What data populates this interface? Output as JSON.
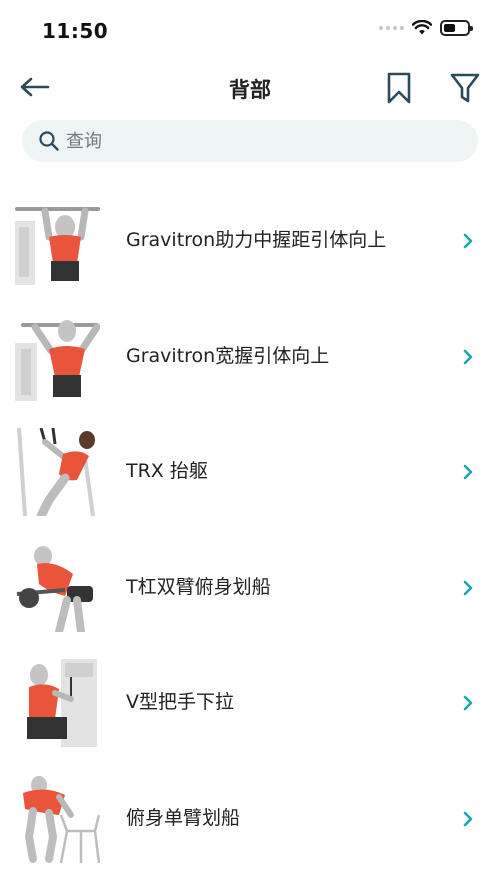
{
  "status": {
    "time": "11:50"
  },
  "nav": {
    "title": "背部"
  },
  "search": {
    "placeholder": "查询"
  },
  "exercises": [
    {
      "label": "Gravitron助力中握距引体向上",
      "icon": "assisted-pullup-figure"
    },
    {
      "label": "Gravitron宽握引体向上",
      "icon": "assisted-wide-pullup-figure"
    },
    {
      "label": "TRX 抬躯",
      "icon": "trx-row-figure"
    },
    {
      "label": "T杠双臂俯身划船",
      "icon": "tbar-row-figure"
    },
    {
      "label": "V型把手下拉",
      "icon": "v-handle-pulldown-figure"
    },
    {
      "label": "俯身单臂划船",
      "icon": "one-arm-row-figure"
    }
  ],
  "colors": {
    "accent": "#1aa7b0",
    "icon_dark": "#2b4a5c",
    "muscle": "#e8553a",
    "search_bg": "#eff4f5"
  }
}
